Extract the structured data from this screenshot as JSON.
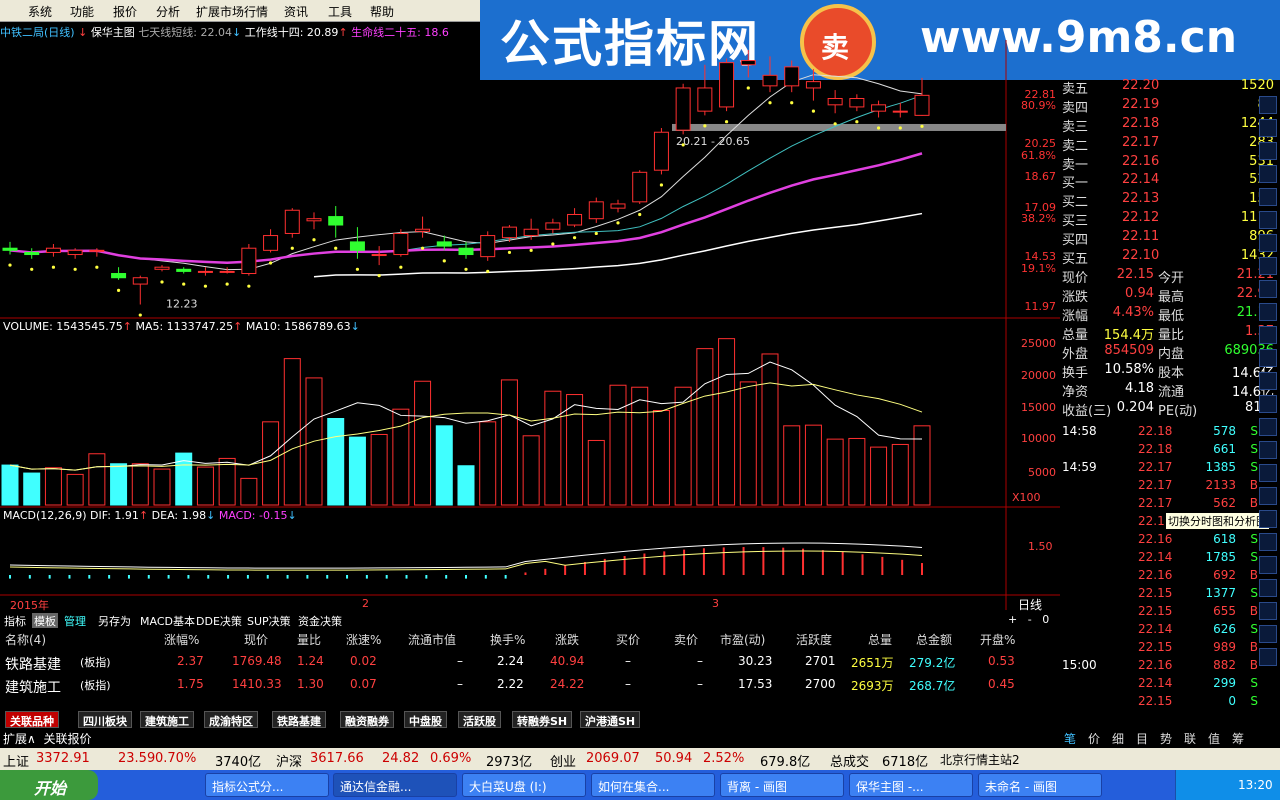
{
  "menu": [
    "系统",
    "功能",
    "报价",
    "分析",
    "扩展市场行情",
    "资讯",
    "工具",
    "帮助"
  ],
  "banner": {
    "cn": "公式指标网",
    "url": "www.9m8.cn",
    "logo_char": "卖"
  },
  "title": {
    "stock": "中铁二局(日线)",
    "indicator": "保华主图",
    "ma7": "七天线短线: 22.04",
    "ma14": "工作线十四: 20.89",
    "ma25": "生命线二十五: 18.6"
  },
  "price_axis": [
    "22.81",
    "80.9%",
    "20.25",
    "61.8%",
    "18.67",
    "17.09",
    "38.2%",
    "14.53",
    "19.1%",
    "11.97"
  ],
  "price_axis_colors": [
    "#ff3333",
    "#ff3333",
    "#ff3333",
    "#ff3333",
    "#ff3333",
    "#ff3333",
    "#ff3333",
    "#ff3333",
    "#ff3333",
    "#ff3333"
  ],
  "annotations": {
    "low": "12.23",
    "range": "20.21 - 20.65"
  },
  "volume": {
    "label": "VOLUME: 1543545.75",
    "ma5": "MA5: 1133747.25",
    "ma10": "MA10: 1586789.63",
    "axis": [
      "25000",
      "20000",
      "15000",
      "10000",
      "5000"
    ],
    "unit": "X100"
  },
  "macd": {
    "label": "MACD(12,26,9)",
    "dif": "DIF: 1.91",
    "dea": "DEA: 1.98",
    "macd": "MACD: -0.15",
    "axis": "1.50"
  },
  "date_axis": {
    "year": "2015年",
    "m2": "2",
    "m3": "3",
    "period": "日线"
  },
  "chart_data": {
    "type": "candlestick",
    "candles": [
      {
        "o": 14.9,
        "h": 15.2,
        "l": 14.6,
        "c": 14.8
      },
      {
        "o": 14.7,
        "h": 14.9,
        "l": 14.4,
        "c": 14.6
      },
      {
        "o": 14.7,
        "h": 15.1,
        "l": 14.5,
        "c": 14.9
      },
      {
        "o": 14.6,
        "h": 14.9,
        "l": 14.4,
        "c": 14.8
      },
      {
        "o": 14.8,
        "h": 14.9,
        "l": 14.5,
        "c": 14.8
      },
      {
        "o": 13.7,
        "h": 14.0,
        "l": 13.4,
        "c": 13.5
      },
      {
        "o": 13.2,
        "h": 13.6,
        "l": 12.23,
        "c": 13.5
      },
      {
        "o": 13.9,
        "h": 14.1,
        "l": 13.8,
        "c": 14.0
      },
      {
        "o": 13.9,
        "h": 14.0,
        "l": 13.7,
        "c": 13.8
      },
      {
        "o": 13.8,
        "h": 14.0,
        "l": 13.6,
        "c": 13.8
      },
      {
        "o": 13.8,
        "h": 14.0,
        "l": 13.7,
        "c": 13.8
      },
      {
        "o": 13.7,
        "h": 15.1,
        "l": 13.6,
        "c": 14.9
      },
      {
        "o": 14.8,
        "h": 15.8,
        "l": 14.7,
        "c": 15.5
      },
      {
        "o": 15.6,
        "h": 16.8,
        "l": 15.4,
        "c": 16.7
      },
      {
        "o": 16.2,
        "h": 16.6,
        "l": 15.8,
        "c": 16.3
      },
      {
        "o": 16.4,
        "h": 16.9,
        "l": 15.4,
        "c": 16.0
      },
      {
        "o": 15.2,
        "h": 15.9,
        "l": 14.4,
        "c": 14.8
      },
      {
        "o": 14.6,
        "h": 15.0,
        "l": 14.1,
        "c": 14.6
      },
      {
        "o": 14.6,
        "h": 15.8,
        "l": 14.5,
        "c": 15.6
      },
      {
        "o": 15.7,
        "h": 16.4,
        "l": 15.4,
        "c": 15.8
      },
      {
        "o": 15.2,
        "h": 15.5,
        "l": 14.8,
        "c": 15.0
      },
      {
        "o": 14.9,
        "h": 15.2,
        "l": 14.4,
        "c": 14.6
      },
      {
        "o": 14.5,
        "h": 15.7,
        "l": 14.3,
        "c": 15.5
      },
      {
        "o": 15.4,
        "h": 16.0,
        "l": 15.2,
        "c": 15.9
      },
      {
        "o": 15.5,
        "h": 16.3,
        "l": 15.3,
        "c": 15.8
      },
      {
        "o": 15.8,
        "h": 16.3,
        "l": 15.6,
        "c": 16.1
      },
      {
        "o": 16.0,
        "h": 16.8,
        "l": 15.9,
        "c": 16.5
      },
      {
        "o": 16.3,
        "h": 17.3,
        "l": 16.1,
        "c": 17.1
      },
      {
        "o": 16.8,
        "h": 17.2,
        "l": 16.6,
        "c": 17.0
      },
      {
        "o": 17.1,
        "h": 18.6,
        "l": 17.0,
        "c": 18.5
      },
      {
        "o": 18.6,
        "h": 20.6,
        "l": 18.4,
        "c": 20.4
      },
      {
        "o": 20.5,
        "h": 22.7,
        "l": 20.3,
        "c": 22.5
      },
      {
        "o": 21.4,
        "h": 23.6,
        "l": 21.2,
        "c": 22.5
      },
      {
        "o": 21.6,
        "h": 23.9,
        "l": 21.4,
        "c": 23.7
      },
      {
        "o": 23.6,
        "h": 24.3,
        "l": 23.0,
        "c": 23.8
      },
      {
        "o": 22.6,
        "h": 24.0,
        "l": 22.3,
        "c": 23.1
      },
      {
        "o": 22.6,
        "h": 23.8,
        "l": 22.3,
        "c": 23.5
      },
      {
        "o": 22.5,
        "h": 23.4,
        "l": 21.9,
        "c": 22.8
      },
      {
        "o": 21.7,
        "h": 22.4,
        "l": 21.3,
        "c": 22.0
      },
      {
        "o": 21.6,
        "h": 22.2,
        "l": 21.4,
        "c": 22.0
      },
      {
        "o": 21.4,
        "h": 21.9,
        "l": 21.1,
        "c": 21.7
      },
      {
        "o": 21.4,
        "h": 21.8,
        "l": 21.1,
        "c": 21.4
      },
      {
        "o": 21.2,
        "h": 22.98,
        "l": 21.18,
        "c": 22.15
      }
    ],
    "volumes": [
      6000,
      4800,
      5600,
      4600,
      7700,
      6200,
      6200,
      5400,
      7800,
      5700,
      7000,
      4000,
      12500,
      22000,
      19100,
      13000,
      10200,
      10600,
      14400,
      18600,
      11900,
      5900,
      12500,
      18800,
      10400,
      17100,
      16600,
      9700,
      18000,
      17700,
      14200,
      17700,
      23500,
      25000,
      18500,
      22700,
      11900,
      12000,
      9900,
      10000,
      8700,
      9100,
      11900
    ],
    "ma_lines": [
      "ma7",
      "ma14",
      "ma25",
      "ma60"
    ],
    "price_range": [
      11.97,
      24.3
    ],
    "volume_range": [
      0,
      26000
    ]
  },
  "orderbook": {
    "asks": [
      {
        "label": "卖五",
        "price": "22.20",
        "vol": "1520"
      },
      {
        "label": "卖四",
        "price": "22.19",
        "vol": "89"
      },
      {
        "label": "卖三",
        "price": "22.18",
        "vol": "1244"
      },
      {
        "label": "卖二",
        "price": "22.17",
        "vol": "283"
      },
      {
        "label": "卖一",
        "price": "22.16",
        "vol": "531"
      }
    ],
    "bids": [
      {
        "label": "买一",
        "price": "22.14",
        "vol": "524"
      },
      {
        "label": "买二",
        "price": "22.13",
        "vol": "152"
      },
      {
        "label": "买三",
        "price": "22.12",
        "vol": "1113"
      },
      {
        "label": "买四",
        "price": "22.11",
        "vol": "896"
      },
      {
        "label": "买五",
        "price": "22.10",
        "vol": "1432"
      }
    ]
  },
  "quote": [
    {
      "l1": "现价",
      "v1": "22.15",
      "l2": "今开",
      "v2": "21.21",
      "c1": "#ff4040",
      "c2": "#ff4040"
    },
    {
      "l1": "涨跌",
      "v1": "0.94",
      "l2": "最高",
      "v2": "22.98",
      "c1": "#ff4040",
      "c2": "#ff4040"
    },
    {
      "l1": "涨幅",
      "v1": "4.43%",
      "l2": "最低",
      "v2": "21.18",
      "c1": "#ff4040",
      "c2": "#30ff30"
    },
    {
      "l1": "总量",
      "v1": "154.4万",
      "l2": "量比",
      "v2": "1.37",
      "c1": "#ffff40",
      "c2": "#ff4040"
    },
    {
      "l1": "外盘",
      "v1": "854509",
      "l2": "内盘",
      "v2": "689036",
      "c1": "#ff4040",
      "c2": "#30ff30"
    },
    {
      "l1": "换手",
      "v1": "10.58%",
      "l2": "股本",
      "v2": "14.6亿",
      "c1": "#ffffff",
      "c2": "#ffffff"
    },
    {
      "l1": "净资",
      "v1": "4.18",
      "l2": "流通",
      "v2": "14.6亿",
      "c1": "#ffffff",
      "c2": "#ffffff"
    },
    {
      "l1": "收益(三)",
      "v1": "0.204",
      "l2": "PE(动)",
      "v2": "81.3",
      "c1": "#ffffff",
      "c2": "#ffffff"
    }
  ],
  "ticks": [
    {
      "t": "14:58",
      "p": "22.18",
      "v": "578",
      "s": "S"
    },
    {
      "t": "",
      "p": "22.18",
      "v": "661",
      "s": "S"
    },
    {
      "t": "14:59",
      "p": "22.17",
      "v": "1385",
      "s": "S"
    },
    {
      "t": "",
      "p": "22.17",
      "v": "2133",
      "s": "B"
    },
    {
      "t": "",
      "p": "22.17",
      "v": "562",
      "s": "B"
    },
    {
      "t": "",
      "p": "22.1",
      "v": "",
      "s": ""
    },
    {
      "t": "",
      "p": "22.16",
      "v": "618",
      "s": "S"
    },
    {
      "t": "",
      "p": "22.14",
      "v": "1785",
      "s": "S"
    },
    {
      "t": "",
      "p": "22.16",
      "v": "692",
      "s": "B"
    },
    {
      "t": "",
      "p": "22.15",
      "v": "1377",
      "s": "S"
    },
    {
      "t": "",
      "p": "22.15",
      "v": "655",
      "s": "B"
    },
    {
      "t": "",
      "p": "22.14",
      "v": "626",
      "s": "S"
    },
    {
      "t": "",
      "p": "22.15",
      "v": "989",
      "s": "B"
    },
    {
      "t": "15:00",
      "p": "22.16",
      "v": "882",
      "s": "B"
    },
    {
      "t": "",
      "p": "22.14",
      "v": "299",
      "s": "S"
    },
    {
      "t": "",
      "p": "22.15",
      "v": "0",
      "s": "S"
    }
  ],
  "tooltip": "切换分时图和分析图",
  "left_tabs": [
    "指标",
    "模板",
    "管理",
    "另存为",
    "MACD基本",
    "DDE决策",
    "SUP决策",
    "资金决策"
  ],
  "list_headers": [
    "名称(4)",
    "涨幅%",
    "现价",
    "量比",
    "涨速%",
    "流通市值",
    "换手%",
    "涨跌",
    "买价",
    "卖价",
    "市盈(动)",
    "活跃度",
    "总量",
    "总金额",
    "开盘%"
  ],
  "list_rows": [
    [
      "铁路基建",
      "(板指)",
      "2.37",
      "1769.48",
      "1.24",
      "0.02",
      "–",
      "2.24",
      "40.94",
      "–",
      "–",
      "30.23",
      "2701",
      "2651万",
      "279.2亿",
      "0.53"
    ],
    [
      "建筑施工",
      "(板指)",
      "1.75",
      "1410.33",
      "1.30",
      "0.07",
      "–",
      "2.22",
      "24.22",
      "–",
      "–",
      "17.53",
      "2700",
      "2693万",
      "268.7亿",
      "0.45"
    ]
  ],
  "bottom_tabs": [
    "关联品种",
    "四川板块",
    "建筑施工",
    "成渝特区",
    "铁路基建",
    "融资融券",
    "中盘股",
    "活跃股",
    "转融券SH",
    "沪港通SH"
  ],
  "expand_tabs": [
    "扩展∧",
    "关联报价"
  ],
  "right_tabs": [
    "笔",
    "价",
    "细",
    "目",
    "势",
    "联",
    "值",
    "筹"
  ],
  "status": {
    "sh_label": "上证",
    "sh": "3372.91",
    "sh_chg": "23.59",
    "sh_pct": "0.70%",
    "sh_amt": "3740亿",
    "sz_label": "沪深",
    "sz": "3617.66",
    "sz_chg": "24.82",
    "sz_pct": "0.69%",
    "sz_amt": "2973亿",
    "cy_label": "创业",
    "cy": "2069.07",
    "cy_chg": "50.94",
    "cy_pct": "2.52%",
    "cy_amt": "679.8亿",
    "total_label": "总成交",
    "total": "6718亿",
    "server": "北京行情主站2"
  },
  "taskbar": {
    "start": "开始",
    "tasks": [
      "指标公式分...",
      "通达信金融...",
      "大白菜U盘 (I:)",
      "如何在集合...",
      "背离 - 画图",
      "保华主图 -...",
      "未命名 - 画图"
    ],
    "clock": "13:20"
  }
}
